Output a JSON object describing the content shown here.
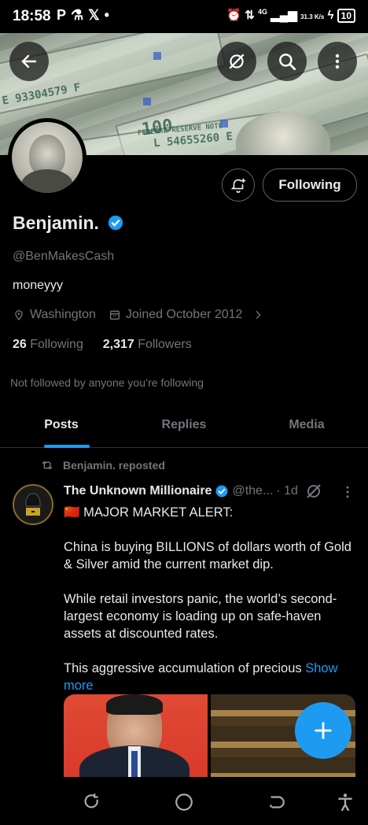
{
  "status_bar": {
    "time": "18:58",
    "network": "4G",
    "speed": "31.3 K/s",
    "battery": "10"
  },
  "profile": {
    "name": "Benjamin.",
    "handle": "@BenMakesCash",
    "bio": "moneyyy",
    "location": "Washington",
    "joined": "Joined October 2012",
    "following_count": "26",
    "following_label": "Following",
    "followers_count": "2,317",
    "followers_label": "Followers",
    "not_followed_text": "Not followed by anyone you’re following",
    "follow_button_label": "Following"
  },
  "tabs": [
    {
      "label": "Posts",
      "active": true
    },
    {
      "label": "Replies",
      "active": false
    },
    {
      "label": "Media",
      "active": false
    }
  ],
  "post": {
    "repost_label": "Benjamin. reposted",
    "author": "The Unknown Millionaire",
    "handle": "@the...",
    "time": "· 1d",
    "line1": "🇨🇳 MAJOR MARKET ALERT:",
    "para1": "China is buying BILLIONS of dollars worth of Gold & Silver amid the current market dip.",
    "para2": "While retail investors panic, the world’s second-largest economy is loading up on safe-haven assets at discounted rates.",
    "para3": "This aggressive accumulation of precious",
    "show_more": "Show more"
  },
  "banner_serials": {
    "s1": "E 93304579 F",
    "s2": "L 54655260 E",
    "s3": "FEDERAL RESERVE NOTE",
    "s4": "100"
  },
  "colors": {
    "accent": "#1d9bf0",
    "background": "#000000",
    "muted_text": "#71767b",
    "primary_text": "#e7e9ea"
  }
}
